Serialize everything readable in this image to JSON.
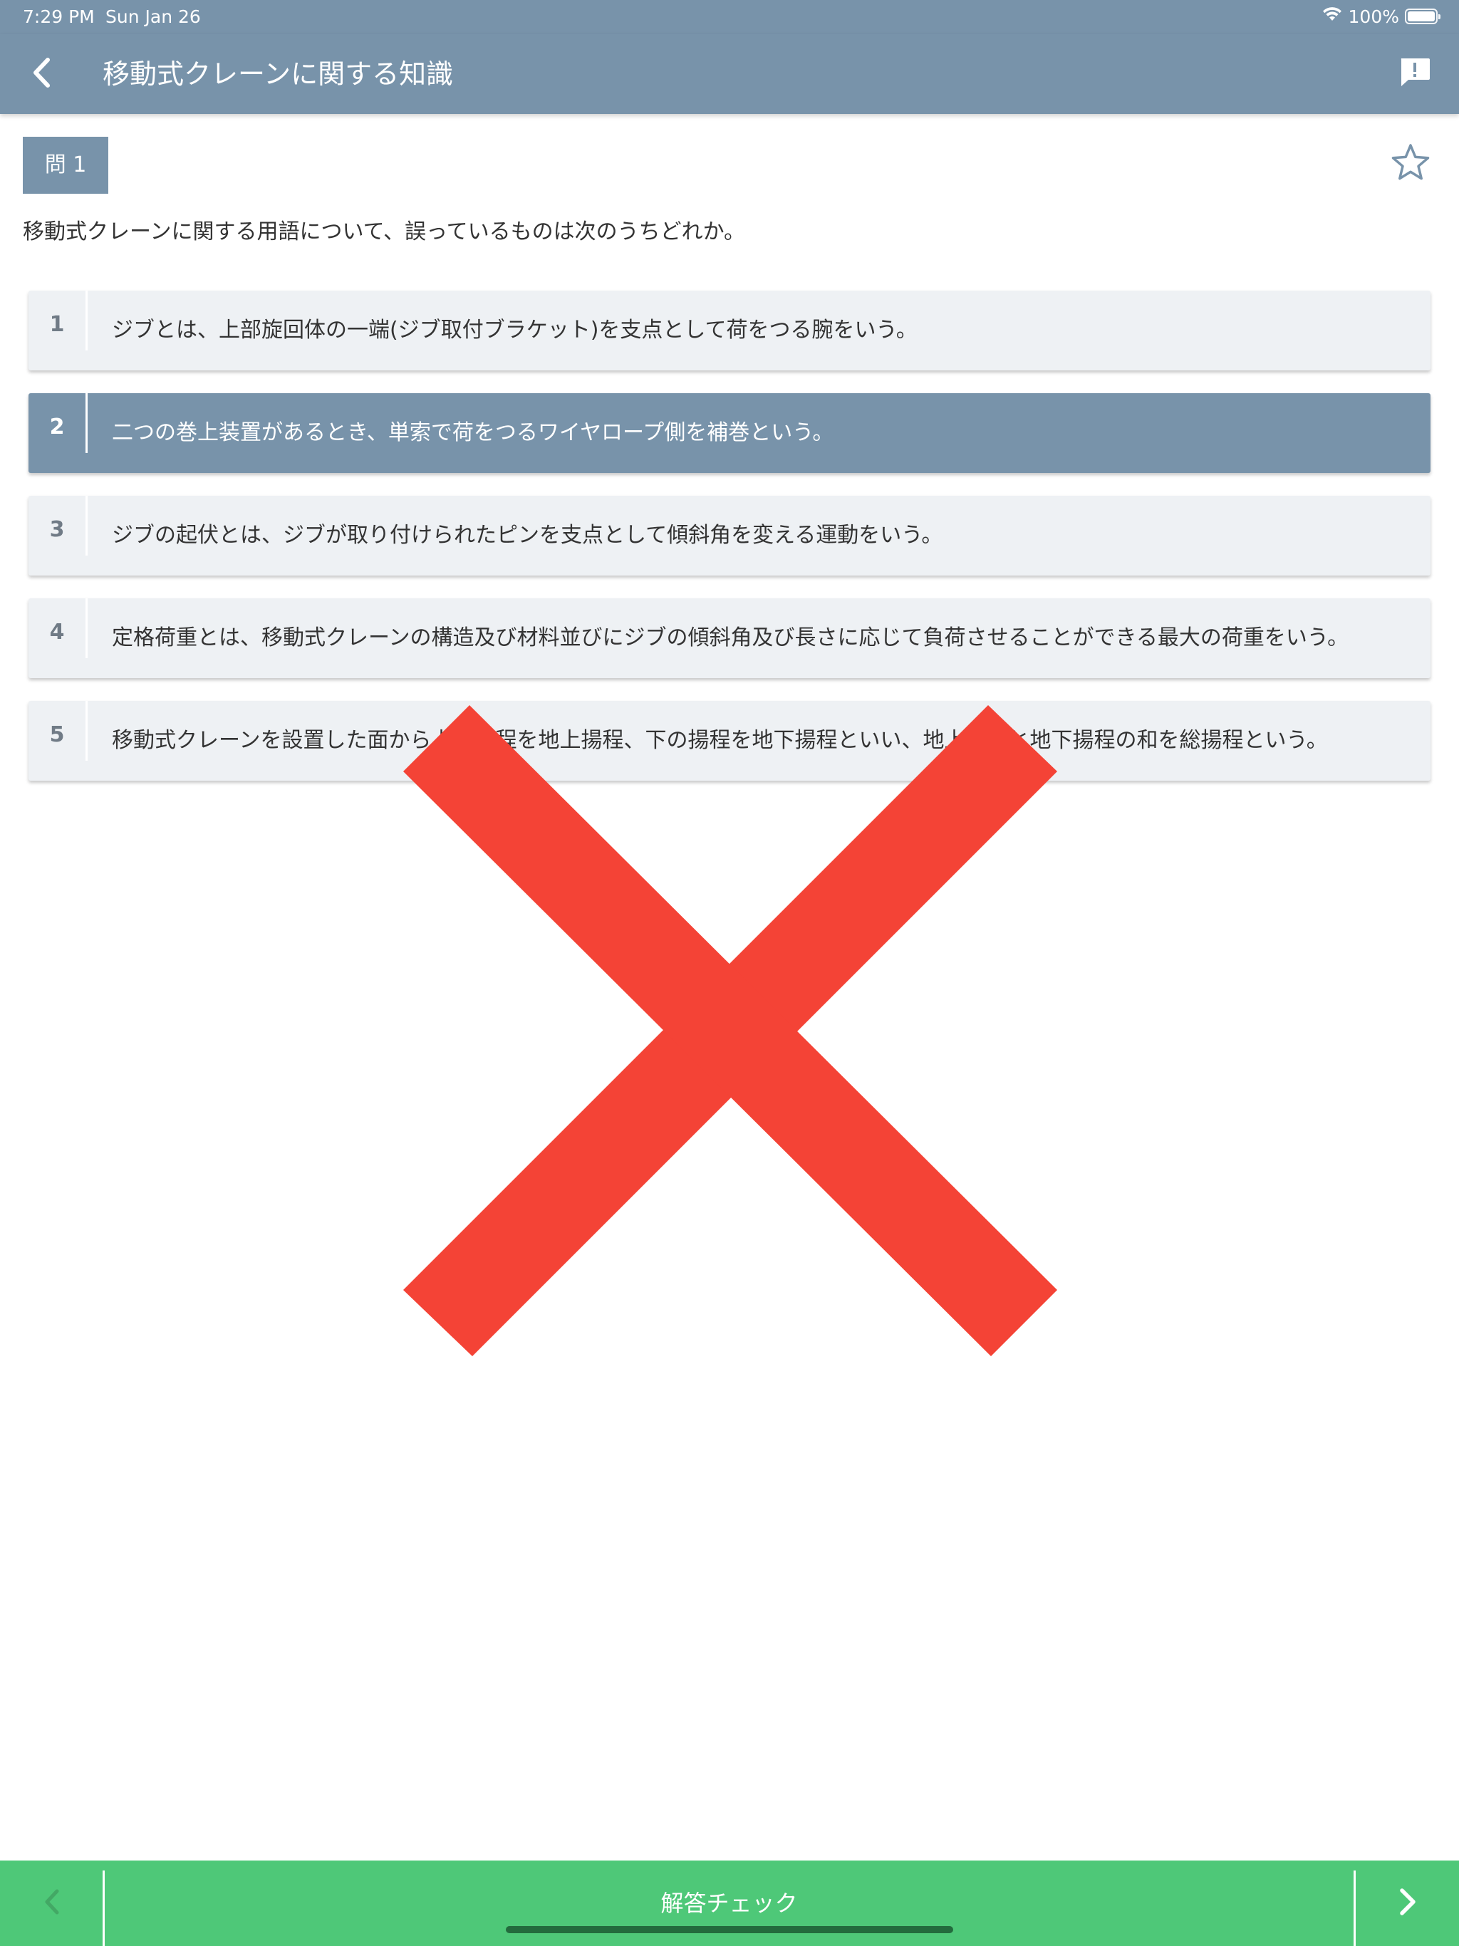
{
  "status_bar": {
    "time": "7:29 PM",
    "date": "Sun Jan 26",
    "battery": "100%"
  },
  "nav": {
    "title": "移動式クレーンに関する知識",
    "back_icon": "chevron-left-icon",
    "report_icon": "report-icon"
  },
  "question": {
    "label": "問 1",
    "text": "移動式クレーンに関する用語について、誤っているものは次のうちどれか。",
    "favorite_icon": "star-outline-icon"
  },
  "choices": [
    {
      "number": "1",
      "text": "ジブとは、上部旋回体の一端(ジブ取付ブラケット)を支点として荷をつる腕をいう。",
      "selected": false
    },
    {
      "number": "2",
      "text": "二つの巻上装置があるとき、単索で荷をつるワイヤロープ側を補巻という。",
      "selected": true
    },
    {
      "number": "3",
      "text": "ジブの起伏とは、ジブが取り付けられたピンを支点として傾斜角を変える運動をいう。",
      "selected": false
    },
    {
      "number": "4",
      "text": "定格荷重とは、移動式クレーンの構造及び材料並びにジブの傾斜角及び長さに応じて負荷させることができる最大の荷重をいう。",
      "selected": false
    },
    {
      "number": "5",
      "text": "移動式クレーンを設置した面から上の揚程を地上揚程、下の揚程を地下揚程といい、地上揚程と地下揚程の和を総揚程という。",
      "selected": false
    }
  ],
  "result": {
    "mark_icon": "wrong-cross-icon",
    "mark_color": "#f44336"
  },
  "bottom_bar": {
    "check_label": "解答チェック",
    "prev_icon": "chevron-left-icon",
    "next_icon": "chevron-right-icon"
  },
  "colors": {
    "header": "#7893aa",
    "selected_choice": "#7893aa",
    "choice_background": "#eef1f4",
    "bottom_bar": "#4ec878"
  }
}
